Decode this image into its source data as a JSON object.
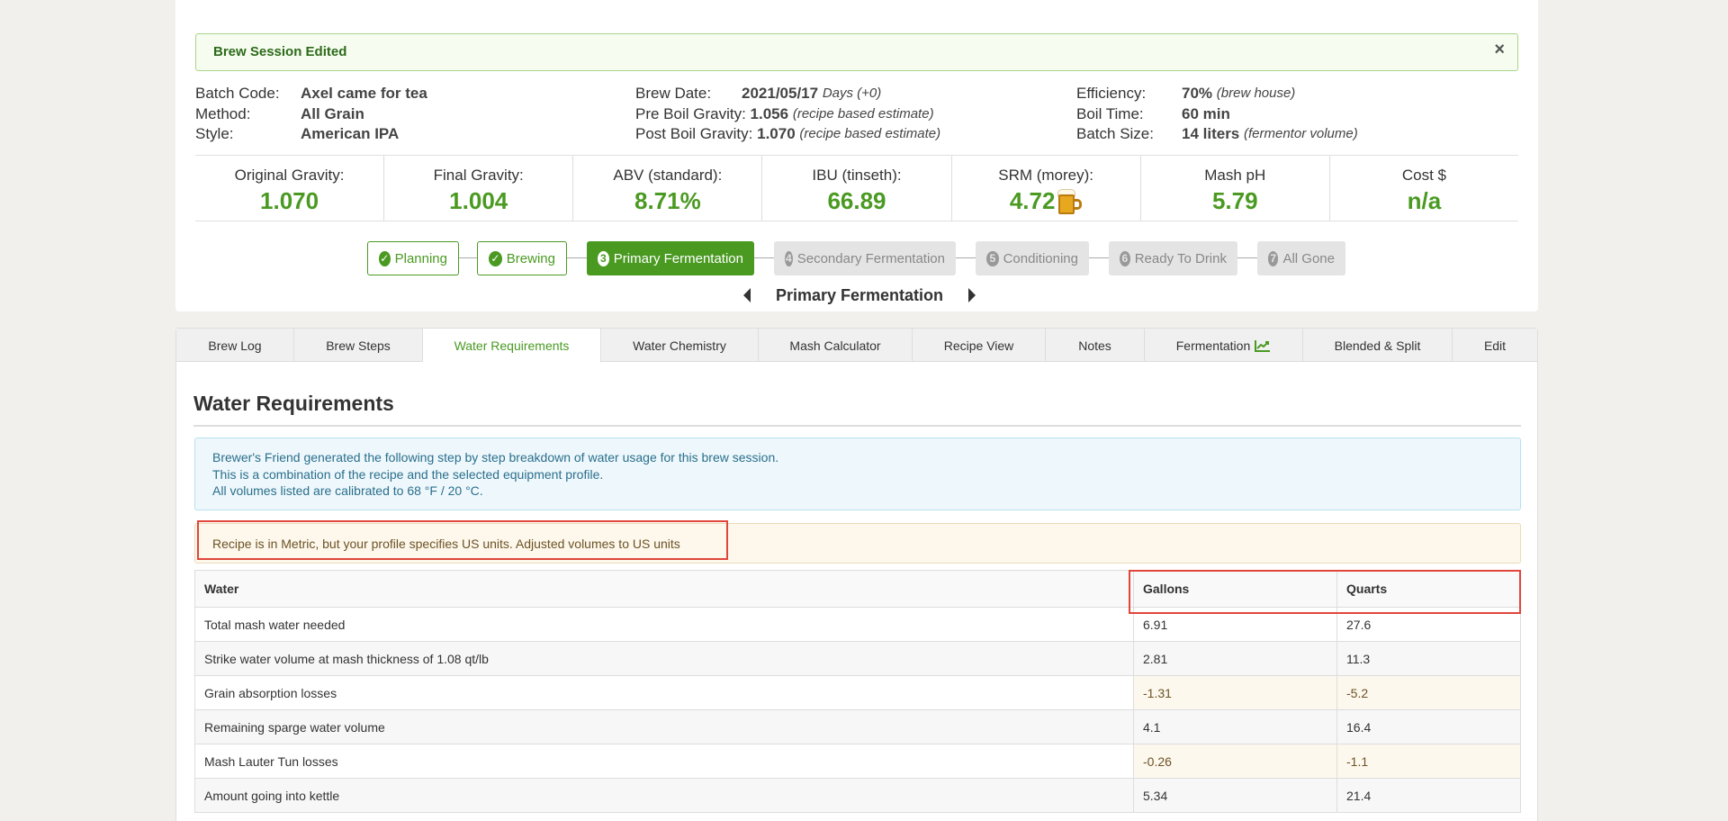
{
  "alert": {
    "title": "Brew Session Edited",
    "close": "×"
  },
  "meta": {
    "batch_code_label": "Batch Code:",
    "batch_code": "Axel came for tea",
    "method_label": "Method:",
    "method": "All Grain",
    "style_label": "Style:",
    "style": "American IPA",
    "brew_date_label": "Brew Date:",
    "brew_date": "2021/05/17",
    "brew_date_days": "Days (+0)",
    "pre_boil_label": "Pre Boil Gravity:",
    "pre_boil": "1.056",
    "pre_boil_note": "(recipe based estimate)",
    "post_boil_label": "Post Boil Gravity:",
    "post_boil": "1.070",
    "post_boil_note": "(recipe based estimate)",
    "efficiency_label": "Efficiency:",
    "efficiency": "70%",
    "efficiency_note": "(brew house)",
    "boil_time_label": "Boil Time:",
    "boil_time": "60 min",
    "batch_size_label": "Batch Size:",
    "batch_size": "14 liters",
    "batch_size_note": "(fermentor volume)"
  },
  "stats": [
    {
      "label": "Original Gravity:",
      "value": "1.070"
    },
    {
      "label": "Final Gravity:",
      "value": "1.004"
    },
    {
      "label": "ABV (standard):",
      "value": "8.71%"
    },
    {
      "label": "IBU (tinseth):",
      "value": "66.89"
    },
    {
      "label": "SRM (morey):",
      "value": "4.72",
      "icon": "beer-mug-icon"
    },
    {
      "label": "Mash pH",
      "value": "5.79"
    },
    {
      "label": "Cost $",
      "value": "n/a"
    }
  ],
  "stages": [
    {
      "label": "Planning",
      "state": "done"
    },
    {
      "label": "Brewing",
      "state": "done"
    },
    {
      "num": "3",
      "label": "Primary Fermentation",
      "state": "active"
    },
    {
      "num": "4",
      "label": "Secondary Fermentation",
      "state": "todo"
    },
    {
      "num": "5",
      "label": "Conditioning",
      "state": "todo"
    },
    {
      "num": "6",
      "label": "Ready To Drink",
      "state": "todo"
    },
    {
      "num": "7",
      "label": "All Gone",
      "state": "todo"
    }
  ],
  "stage_nav": {
    "title": "Primary Fermentation"
  },
  "tabs": [
    {
      "label": "Brew Log"
    },
    {
      "label": "Brew Steps"
    },
    {
      "label": "Water Requirements",
      "active": true
    },
    {
      "label": "Water Chemistry"
    },
    {
      "label": "Mash Calculator"
    },
    {
      "label": "Recipe View"
    },
    {
      "label": "Notes"
    },
    {
      "label": "Fermentation",
      "icon": "chart-icon"
    },
    {
      "label": "Blended & Split"
    },
    {
      "label": "Edit"
    }
  ],
  "section": {
    "title": "Water Requirements"
  },
  "info": {
    "line1": "Brewer's Friend generated the following step by step breakdown of water usage for this brew session.",
    "line2": "This is a combination of the recipe and the selected equipment profile.",
    "line3": "All volumes listed are calibrated to 68 °F / 20 °C."
  },
  "warning": {
    "text": "Recipe is in Metric, but your profile specifies US units. Adjusted volumes to US units"
  },
  "table": {
    "headers": [
      "Water",
      "Gallons",
      "Quarts"
    ],
    "rows": [
      [
        "Total mash water needed",
        "6.91",
        "27.6"
      ],
      [
        "Strike water volume at mash thickness of 1.08 qt/lb",
        "2.81",
        "11.3"
      ],
      [
        "Grain absorption losses",
        "-1.31",
        "-5.2"
      ],
      [
        "Remaining sparge water volume",
        "4.1",
        "16.4"
      ],
      [
        "Mash Lauter Tun losses",
        "-0.26",
        "-1.1"
      ],
      [
        "Amount going into kettle",
        "5.34",
        "21.4"
      ]
    ]
  },
  "colors": {
    "accent_green": "#4a9a22",
    "highlight_red": "#e0463a"
  }
}
